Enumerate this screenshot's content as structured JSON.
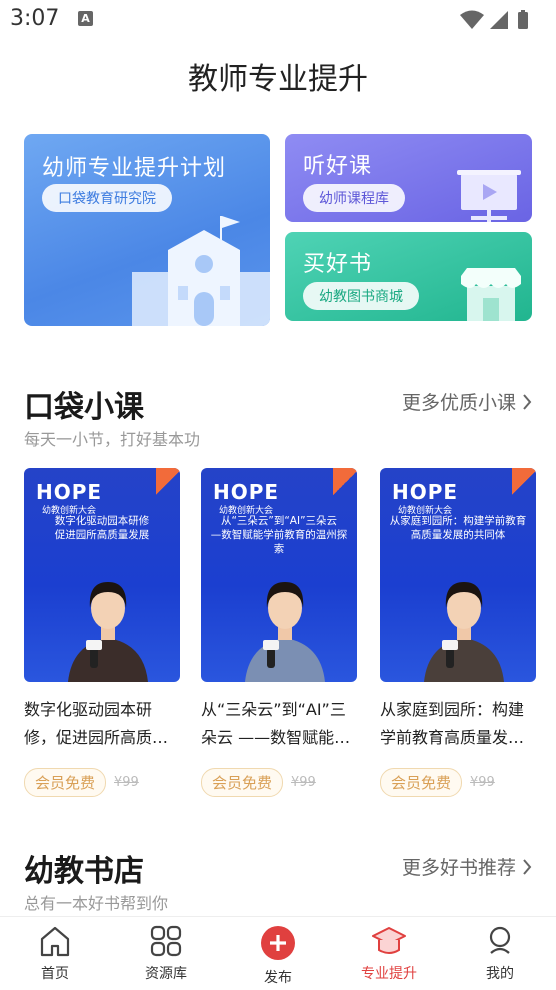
{
  "status_bar": {
    "time": "3:07",
    "notification_letter": "A"
  },
  "page_title": "教师专业提升",
  "cards": {
    "plan": {
      "title": "幼师专业提升计划",
      "pill": "口袋教育研究院"
    },
    "listen": {
      "title": "听好课",
      "pill": "幼师课程库"
    },
    "books": {
      "title": "买好书",
      "pill": "幼教图书商城"
    }
  },
  "section_courses": {
    "title": "口袋小课",
    "subtitle": "每天一小节，打好基本功",
    "more": "更多优质小课"
  },
  "courses": [
    {
      "logo": "HOPE",
      "logo_sub": "幼教创新大会",
      "headline": "数字化驱动园本研修\n促进园所高质量发展",
      "title": "数字化驱动园本研修，促进园所高质…",
      "badge": "会员免费",
      "price": "¥99"
    },
    {
      "logo": "HOPE",
      "logo_sub": "幼教创新大会",
      "headline": "从“三朵云”到“AI”三朵云\n—数智赋能学前教育的温州探索",
      "title": "从“三朵云”到“AI”三朵云 ——数智赋能…",
      "badge": "会员免费",
      "price": "¥99"
    },
    {
      "logo": "HOPE",
      "logo_sub": "幼教创新大会",
      "headline": "从家庭到园所：构建学前教育\n高质量发展的共同体",
      "title": "从家庭到园所：构建学前教育高质量发…",
      "badge": "会员免费",
      "price": "¥99"
    }
  ],
  "section_books": {
    "title": "幼教书店",
    "subtitle": "总有一本好书帮到你",
    "more": "更多好书推荐"
  },
  "tabs": [
    {
      "label": "首页",
      "icon": "home-icon"
    },
    {
      "label": "资源库",
      "icon": "grid-icon"
    },
    {
      "label": "发布",
      "icon": "plus-icon"
    },
    {
      "label": "专业提升",
      "icon": "graduation-cap-icon",
      "active": true
    },
    {
      "label": "我的",
      "icon": "profile-icon"
    }
  ],
  "colors": {
    "accent": "#e0403f",
    "member": "#d9a057",
    "thumb_blue": "#1b3fd0"
  }
}
